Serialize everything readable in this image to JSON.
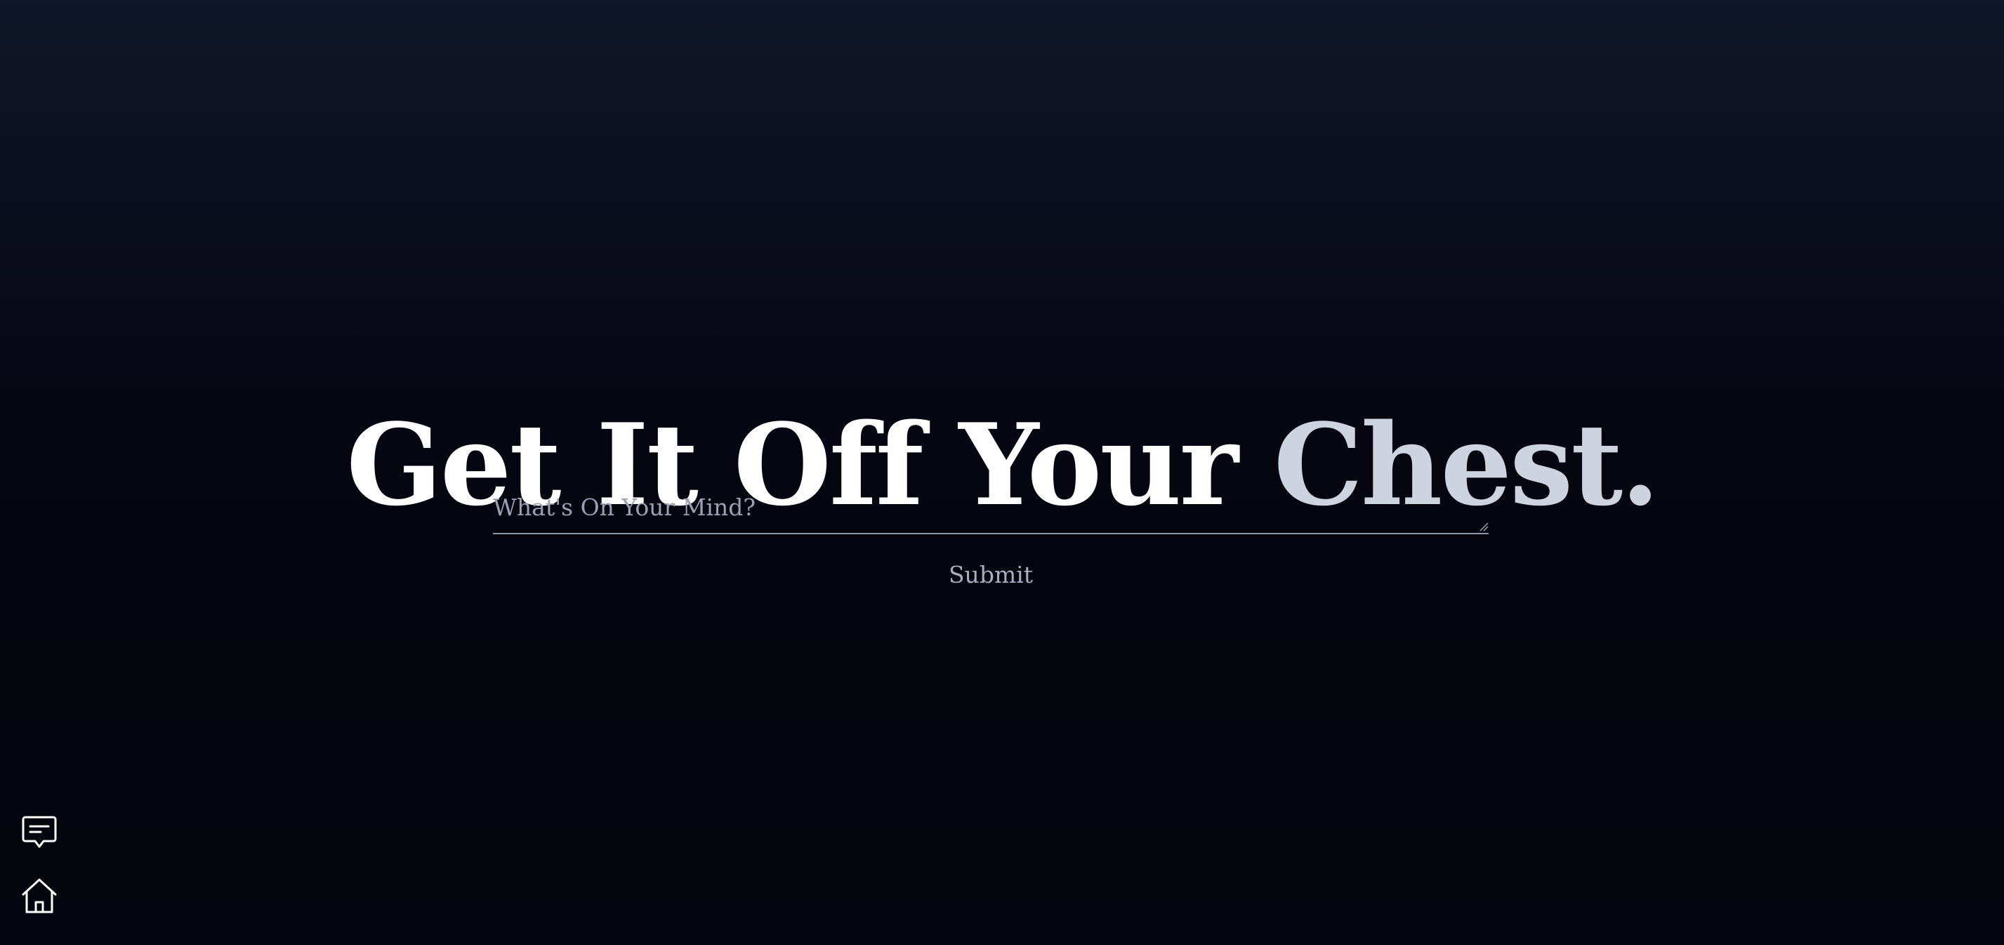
{
  "hero": {
    "lead": "Get It Off Your ",
    "accent": "Chest."
  },
  "form": {
    "textarea": {
      "placeholder": "What's On Your Mind?",
      "value": ""
    },
    "submit_label": "Submit"
  },
  "sidebar": {
    "items": [
      {
        "icon": "chat-bubble-icon"
      },
      {
        "icon": "home-icon"
      }
    ]
  },
  "colors": {
    "background_top": "#10172a",
    "background_bottom": "#05050f",
    "heading": "#ffffff",
    "accent": "#cdd4e0",
    "muted_text": "#9aa1b3"
  }
}
